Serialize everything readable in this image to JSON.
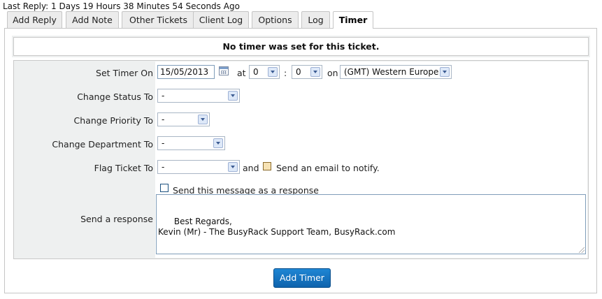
{
  "header": {
    "last_reply": "Last Reply: 1 Days 19 Hours 38 Minutes 54 Seconds Ago"
  },
  "tabs": [
    {
      "label": "Add Reply"
    },
    {
      "label": "Add Note"
    },
    {
      "label": "Other Tickets"
    },
    {
      "label": "Client Log"
    },
    {
      "label": "Options"
    },
    {
      "label": "Log"
    },
    {
      "label": "Timer",
      "active": true
    }
  ],
  "notice": "No timer was set for this ticket.",
  "form": {
    "set_timer_label": "Set Timer On",
    "date_value": "15/05/2013",
    "at_text": "at",
    "hour_value": "0",
    "colon_text": ":",
    "minute_value": "0",
    "on_text": "on",
    "timezone_value": "(GMT) Western Europe",
    "status_label": "Change Status To",
    "status_value": "-",
    "priority_label": "Change Priority To",
    "priority_value": "-",
    "department_label": "Change Department To",
    "department_value": "-",
    "flag_label": "Flag Ticket To",
    "flag_value": "-",
    "and_text": "and",
    "email_notify_text": "Send an email to notify.",
    "send_as_response_text": "Send this message as a response",
    "response_label": "Send a response",
    "response_text": "Best Regards,\nKevin (Mr) - The BusyRack Support Team, BusyRack.com"
  },
  "buttons": {
    "add_timer": "Add Timer"
  },
  "colors": {
    "button": "#1a78c2",
    "panel_bg": "#eef0f0",
    "border": "#c5c5c5"
  }
}
